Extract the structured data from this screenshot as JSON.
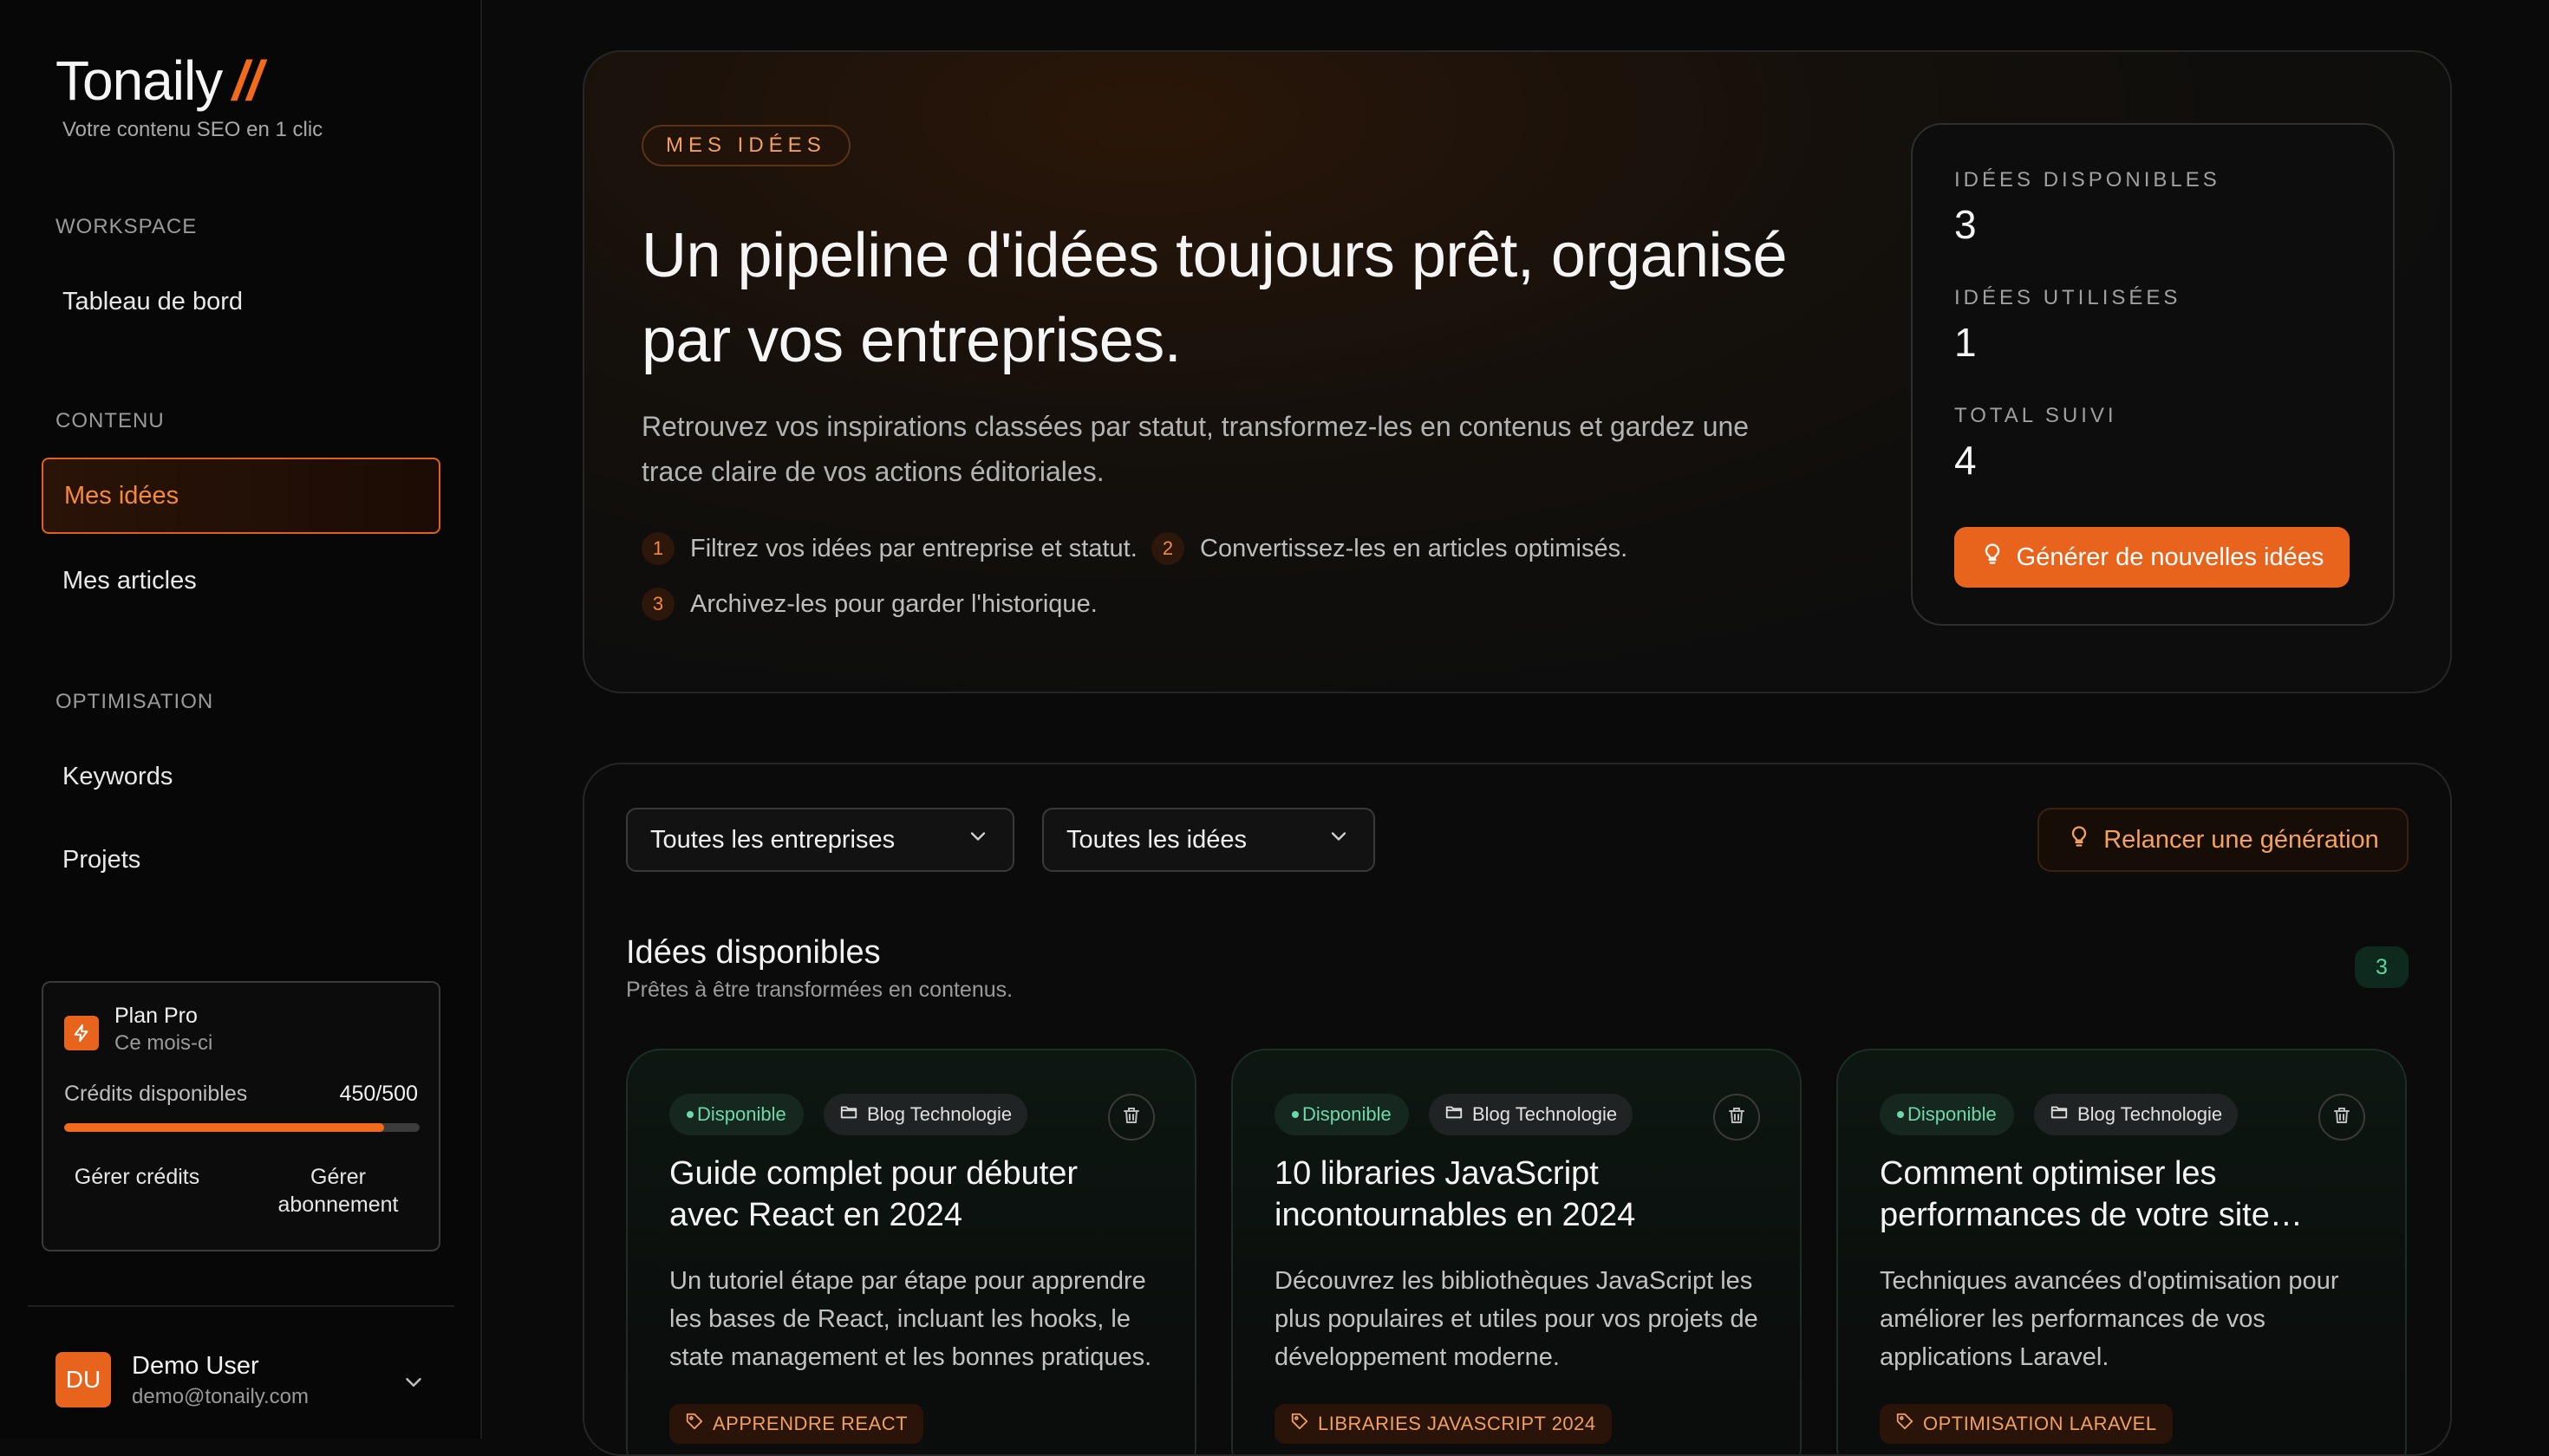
{
  "sidebar": {
    "logo": "Tonaily",
    "logo_mark": "//",
    "tagline": "Votre contenu SEO en 1 clic",
    "sections": {
      "workspace": "WORKSPACE",
      "contenu": "CONTENU",
      "optimisation": "OPTIMISATION"
    },
    "items": {
      "dashboard": "Tableau de bord",
      "ideas": "Mes idées",
      "articles": "Mes articles",
      "keywords": "Keywords",
      "projects": "Projets"
    },
    "plan": {
      "name": "Plan Pro",
      "period": "Ce mois-ci",
      "credits_label": "Crédits disponibles",
      "credits_value": "450/500",
      "credits_progress": 0.9,
      "manage_credits": "Gérer crédits",
      "manage_subscription": "Gérer abonnement"
    },
    "user": {
      "initials": "DU",
      "name": "Demo User",
      "email": "demo@tonaily.com"
    }
  },
  "hero": {
    "badge": "MES IDÉES",
    "title": "Un pipeline d'idées toujours prêt, organisé par vos entreprises.",
    "description": "Retrouvez vos inspirations classées par statut, transformez-les en contenus et gardez une trace claire de vos actions éditoriales.",
    "steps": [
      {
        "num": "1",
        "text": "Filtrez vos idées par entreprise et statut."
      },
      {
        "num": "2",
        "text": "Convertissez-les en articles optimisés."
      },
      {
        "num": "3",
        "text": "Archivez-les pour garder l'historique."
      }
    ],
    "stats": [
      {
        "label": "IDÉES DISPONIBLES",
        "value": "3"
      },
      {
        "label": "IDÉES UTILISÉES",
        "value": "1"
      },
      {
        "label": "TOTAL SUIVI",
        "value": "4"
      }
    ],
    "generate_button": "Générer de nouvelles idées"
  },
  "filters": {
    "company_select": "Toutes les entreprises",
    "status_select": "Toutes les idées",
    "relaunch_button": "Relancer une génération"
  },
  "ideas_section": {
    "title": "Idées disponibles",
    "subtitle": "Prêtes à être transformées en contenus.",
    "count": "3",
    "cards": [
      {
        "status": "Disponible",
        "company": "Blog Technologie",
        "title": "Guide complet pour débuter avec React en 2024",
        "description": "Un tutoriel étape par étape pour apprendre les bases de React, incluant les hooks, le state management et les bonnes pratiques.",
        "keyword": "APPRENDRE REACT"
      },
      {
        "status": "Disponible",
        "company": "Blog Technologie",
        "title": "10 libraries JavaScript incontournables en 2024",
        "description": "Découvrez les bibliothèques JavaScript les plus populaires et utiles pour vos projets de développement moderne.",
        "keyword": "LIBRARIES JAVASCRIPT 2024"
      },
      {
        "status": "Disponible",
        "company": "Blog Technologie",
        "title": "Comment optimiser les performances de votre site…",
        "description": "Techniques avancées d'optimisation pour améliorer les performances de vos applications Laravel.",
        "keyword": "OPTIMISATION LARAVEL"
      }
    ]
  },
  "colors": {
    "accent": "#e8641c",
    "status_green": "#6ed8a8",
    "background": "#0a0a0a"
  },
  "icons": [
    "bolt-icon",
    "lightbulb-icon",
    "chevron-down-icon",
    "folder-icon",
    "trash-icon",
    "tag-icon"
  ]
}
